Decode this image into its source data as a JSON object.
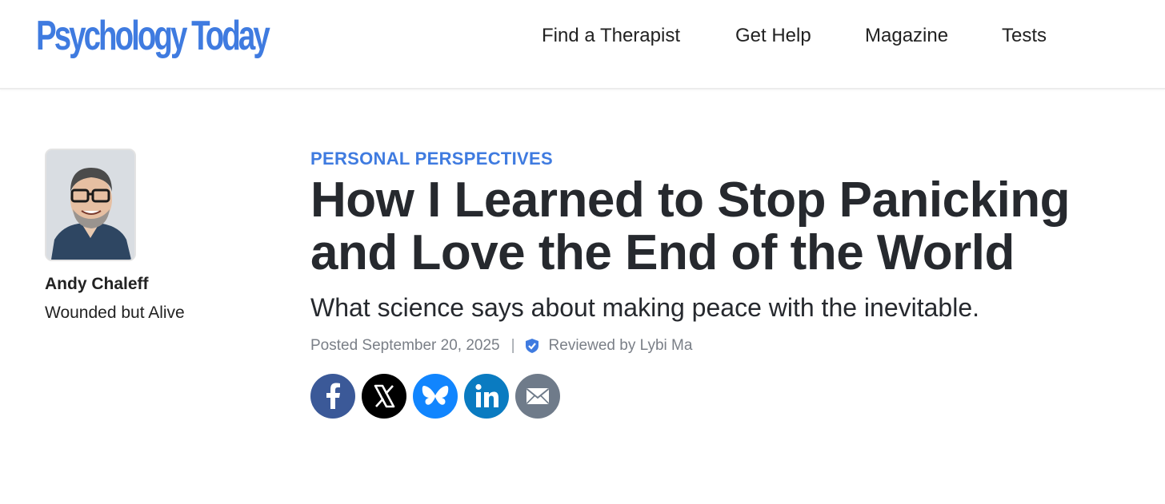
{
  "header": {
    "logo_text": "Psychology Today",
    "brand_color": "#3f7be0",
    "nav": [
      "Find a Therapist",
      "Get Help",
      "Magazine",
      "Tests"
    ]
  },
  "author": {
    "name": "Andy Chaleff",
    "blog_name": "Wounded but Alive"
  },
  "article": {
    "kicker": "PERSONAL PERSPECTIVES",
    "title": "How I Learned to Stop Panicking and Love the End of the World",
    "subtitle": "What science says about making peace with the inevitable.",
    "posted": "Posted September 20, 2025",
    "separator": "|",
    "reviewed": "Reviewed by Lybi Ma"
  },
  "share": [
    {
      "icon": "facebook-icon",
      "color": "#3b5998"
    },
    {
      "icon": "x-icon",
      "color": "#000000"
    },
    {
      "icon": "bluesky-icon",
      "color": "#1185fe"
    },
    {
      "icon": "linkedin-icon",
      "color": "#0a7bc1"
    },
    {
      "icon": "email-icon",
      "color": "#6f7b8a"
    }
  ]
}
